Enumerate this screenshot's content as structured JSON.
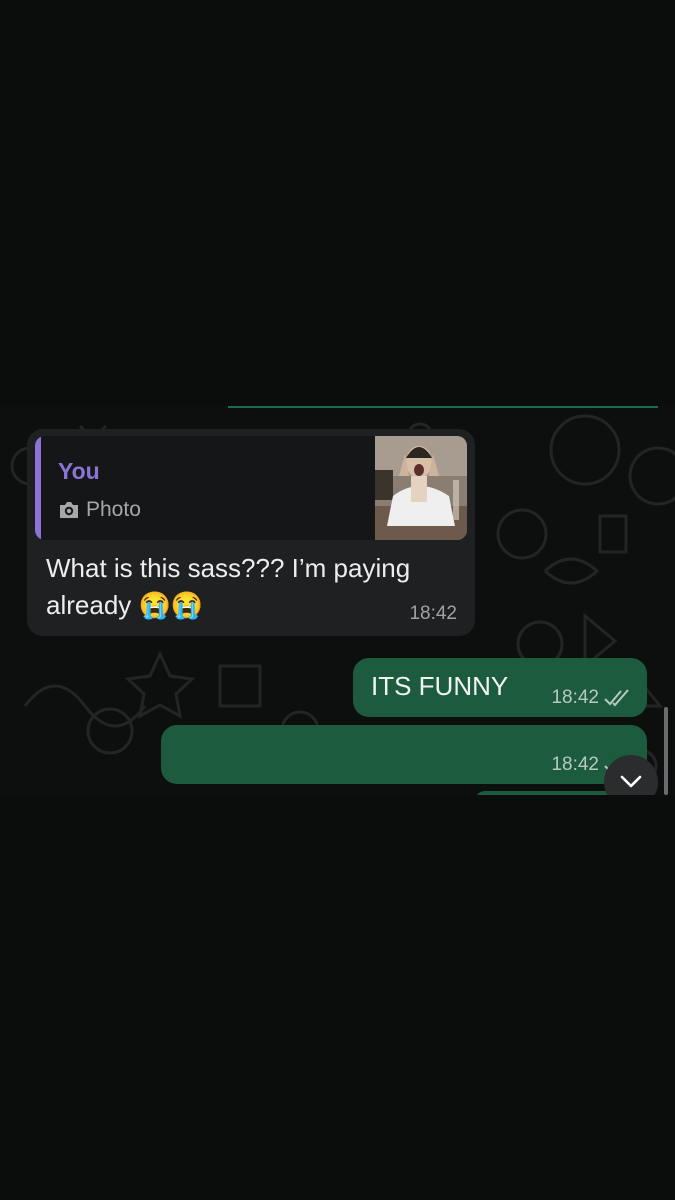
{
  "chat": {
    "incoming": {
      "reply": {
        "author": "You",
        "type_label": "Photo",
        "icon": "camera-icon"
      },
      "text": "What is this sass??? I’m paying already 😭😭",
      "time": "18:42"
    },
    "outgoing": [
      {
        "text": "ITS FUNNY",
        "time": "18:42",
        "status": "read"
      },
      {
        "text": "",
        "time": "18:42",
        "status": "read"
      }
    ]
  },
  "colors": {
    "background": "#0b0c0c",
    "incoming_bubble": "#1f2022",
    "outgoing_bubble": "#1d5b3f",
    "reply_accent": "#8c74d6"
  }
}
